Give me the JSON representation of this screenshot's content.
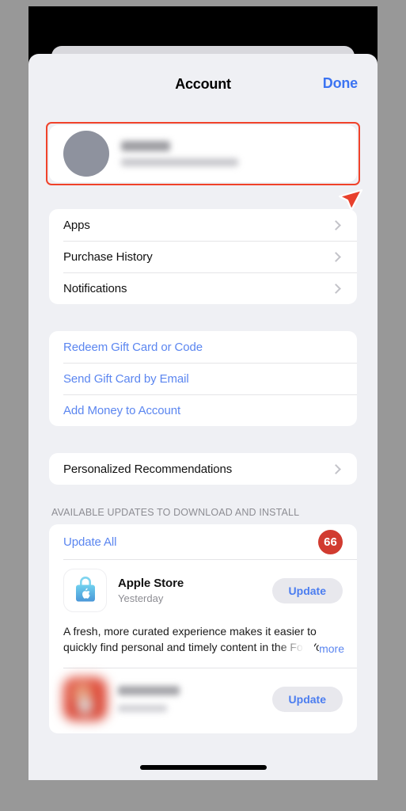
{
  "header": {
    "title": "Account",
    "done_label": "Done"
  },
  "profile": {
    "name_redacted": "",
    "email_redacted": "",
    "avatar_color": "#8e929e"
  },
  "annotation": {
    "box_color": "#f0422a",
    "cursor_color": "#e8402c"
  },
  "menu": {
    "items": [
      {
        "label": "Apps"
      },
      {
        "label": "Purchase History"
      },
      {
        "label": "Notifications"
      }
    ]
  },
  "giftcards": {
    "items": [
      {
        "label": "Redeem Gift Card or Code"
      },
      {
        "label": "Send Gift Card by Email"
      },
      {
        "label": "Add Money to Account"
      }
    ]
  },
  "recommendations": {
    "label": "Personalized Recommendations"
  },
  "updates": {
    "section_header": "AVAILABLE UPDATES TO DOWNLOAD AND INSTALL",
    "update_all_label": "Update All",
    "badge_count": "66",
    "badge_color": "#d13b30",
    "apps": [
      {
        "name": "Apple Store",
        "date": "Yesterday",
        "button_label": "Update",
        "icon": "apple-store-bag-icon",
        "release_notes": "A fresh, more curated experience makes it easier to quickly find personal and timely content in the For You tab, sho",
        "more_label": "more"
      },
      {
        "name": "",
        "date": "",
        "button_label": "Update",
        "icon": "blurred-red-app-icon"
      }
    ]
  },
  "colors": {
    "accent_blue": "#5b86f0",
    "sheet_background": "#eff0f4",
    "card_background": "#ffffff",
    "frame_gray": "#989898"
  }
}
